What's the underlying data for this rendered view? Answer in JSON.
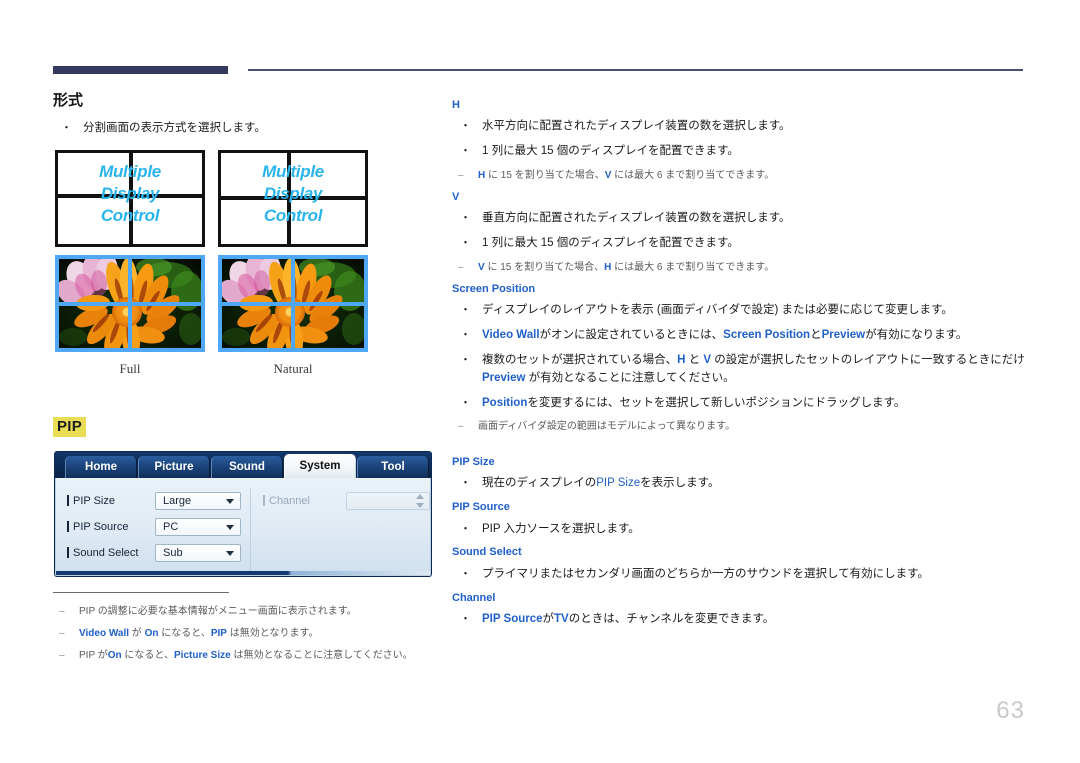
{
  "page": {
    "number": "63"
  },
  "left": {
    "section1": {
      "heading": "形式",
      "bullets": [
        "分割画面の表示方式を選択します。"
      ]
    },
    "figure": {
      "mdc_label_lines": [
        "Multiple",
        "Display",
        "Control"
      ],
      "items": [
        {
          "caption": "Full"
        },
        {
          "caption": "Natural"
        }
      ]
    },
    "section2": {
      "heading": "PIP",
      "heading_highlight": "#e8dd55"
    },
    "osd": {
      "tabs": [
        {
          "label": "Home",
          "active": false
        },
        {
          "label": "Picture",
          "active": false
        },
        {
          "label": "Sound",
          "active": false
        },
        {
          "label": "System",
          "active": true
        },
        {
          "label": "Tool",
          "active": false
        }
      ],
      "left_rows": [
        {
          "label": "PIP Size",
          "value": "Large",
          "control": "dropdown",
          "disabled": false
        },
        {
          "label": "PIP Source",
          "value": "PC",
          "control": "dropdown",
          "disabled": false
        },
        {
          "label": "Sound Select",
          "value": "Sub",
          "control": "dropdown",
          "disabled": false
        }
      ],
      "right_rows": [
        {
          "label": "Channel",
          "value": "",
          "control": "spinner",
          "disabled": true
        }
      ]
    },
    "notes": [
      {
        "dash": "‒",
        "parts": [
          {
            "t": "PIP の調整に必要な基本情報がメニュー画面に表示されます。",
            "s": "plain"
          }
        ]
      },
      {
        "dash": "‒",
        "parts": [
          {
            "t": " Video Wall",
            "s": "hl"
          },
          {
            "t": " が ",
            "s": "plain"
          },
          {
            "t": "On",
            "s": "hl"
          },
          {
            "t": " になると、",
            "s": "plain"
          },
          {
            "t": "PIP",
            "s": "hl"
          },
          {
            "t": " は無効となります。",
            "s": "plain"
          }
        ]
      },
      {
        "dash": "‒",
        "parts": [
          {
            "t": "PIP が",
            "s": "plain"
          },
          {
            "t": "On",
            "s": "hl"
          },
          {
            "t": " になると、",
            "s": "plain"
          },
          {
            "t": "Picture Size",
            "s": "hl"
          },
          {
            "t": " は無効となることに注意してください。",
            "s": "plain"
          }
        ]
      }
    ]
  },
  "right": {
    "blocks": [
      {
        "key": "H",
        "bullets": [
          [
            {
              "t": "水平方向に配置されたディスプレイ装置の数を選択します。",
              "s": "plain"
            }
          ],
          [
            {
              "t": "1 列に最大 15 個のディスプレイを配置できます。",
              "s": "plain"
            }
          ]
        ],
        "notes": [
          {
            "dash": "‒",
            "parts": [
              {
                "t": "H",
                "s": "hl"
              },
              {
                "t": " に 15 を割り当てた場合、",
                "s": "plain"
              },
              {
                "t": "V",
                "s": "hl"
              },
              {
                "t": " には最大 6 まで割り当てできます。",
                "s": "plain"
              }
            ]
          }
        ]
      },
      {
        "key": "V",
        "bullets": [
          [
            {
              "t": "垂直方向に配置されたディスプレイ装置の数を選択します。",
              "s": "plain"
            }
          ],
          [
            {
              "t": "1 列に最大 15 個のディスプレイを配置できます。",
              "s": "plain"
            }
          ]
        ],
        "notes": [
          {
            "dash": "‒",
            "parts": [
              {
                "t": "V",
                "s": "hl"
              },
              {
                "t": " に 15 を割り当てた場合、",
                "s": "plain"
              },
              {
                "t": "H",
                "s": "hl"
              },
              {
                "t": " には最大 6 まで割り当てできます。",
                "s": "plain"
              }
            ]
          }
        ]
      },
      {
        "key": "Screen Position",
        "bullets": [
          [
            {
              "t": "ディスプレイのレイアウトを表示 (画面ディバイダで設定) または必要に応じて変更します。",
              "s": "plain"
            }
          ],
          [
            {
              "t": "Video Wall",
              "s": "hl"
            },
            {
              "t": "がオンに設定されているときには、",
              "s": "plain"
            },
            {
              "t": "Screen Position",
              "s": "hl"
            },
            {
              "t": "と",
              "s": "plain"
            },
            {
              "t": "Preview",
              "s": "hl"
            },
            {
              "t": "が有効になります。",
              "s": "plain"
            }
          ],
          [
            {
              "t": "複数のセットが選択されている場合、",
              "s": "plain"
            },
            {
              "t": "H",
              "s": "hl"
            },
            {
              "t": " と ",
              "s": "plain"
            },
            {
              "t": "V",
              "s": "hl"
            },
            {
              "t": " の設定が選択したセットのレイアウトに一致するときにだけ ",
              "s": "plain"
            },
            {
              "t": "Preview",
              "s": "hl"
            },
            {
              "t": " が有効となることに注意してください。",
              "s": "plain"
            }
          ],
          [
            {
              "t": "Position",
              "s": "hl"
            },
            {
              "t": "を変更するには、セットを選択して新しいポジションにドラッグします。",
              "s": "plain"
            }
          ]
        ],
        "notes": [
          {
            "dash": "‒",
            "parts": [
              {
                "t": "画面ディバイダ設定の範囲はモデルによって異なります。",
                "s": "plain"
              }
            ]
          }
        ]
      }
    ],
    "blocks2": [
      {
        "key": "PIP Size",
        "bullets": [
          [
            {
              "t": "現在のディスプレイの",
              "s": "plain"
            },
            {
              "t": "PIP Size",
              "s": "hl-thin"
            },
            {
              "t": "を表示します。",
              "s": "plain"
            }
          ]
        ],
        "notes": []
      },
      {
        "key": "PIP Source",
        "bullets": [
          [
            {
              "t": "PIP 入力ソースを選択します。",
              "s": "plain"
            }
          ]
        ],
        "notes": []
      },
      {
        "key": "Sound Select",
        "bullets": [
          [
            {
              "t": "プライマリまたはセカンダリ画面のどちらか一方のサウンドを選択して有効にします。",
              "s": "plain"
            }
          ]
        ],
        "notes": []
      },
      {
        "key": "Channel",
        "bullets": [
          [
            {
              "t": "PIP Source",
              "s": "hl"
            },
            {
              "t": "が",
              "s": "plain"
            },
            {
              "t": "TV",
              "s": "hl"
            },
            {
              "t": "のときは、チャンネルを変更できます。",
              "s": "plain"
            }
          ]
        ],
        "notes": []
      }
    ]
  },
  "colors": {
    "rule_dark": "#353b5e",
    "link_blue": "#2060c8",
    "highlight_yellow": "#e8dd55",
    "mdc_cyan": "#2ab4ec",
    "panel_blue": "#4fa8f5"
  }
}
